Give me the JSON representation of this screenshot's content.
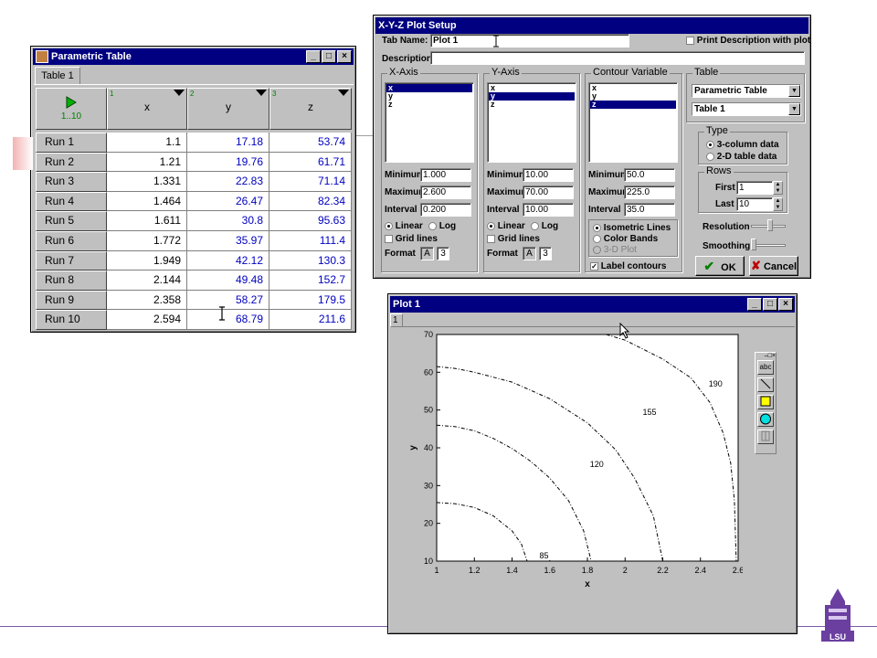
{
  "parametric_table": {
    "title": "Parametric Table",
    "tab": "Table 1",
    "run_range": "1..10",
    "columns": [
      {
        "index": "1",
        "name": "x"
      },
      {
        "index": "2",
        "name": "y"
      },
      {
        "index": "3",
        "name": "z"
      }
    ],
    "rows": [
      {
        "run": "Run 1",
        "x": "1.1",
        "y": "17.18",
        "z": "53.74"
      },
      {
        "run": "Run 2",
        "x": "1.21",
        "y": "19.76",
        "z": "61.71"
      },
      {
        "run": "Run 3",
        "x": "1.331",
        "y": "22.83",
        "z": "71.14"
      },
      {
        "run": "Run 4",
        "x": "1.464",
        "y": "26.47",
        "z": "82.34"
      },
      {
        "run": "Run 5",
        "x": "1.611",
        "y": "30.8",
        "z": "95.63"
      },
      {
        "run": "Run 6",
        "x": "1.772",
        "y": "35.97",
        "z": "111.4"
      },
      {
        "run": "Run 7",
        "x": "1.949",
        "y": "42.12",
        "z": "130.3"
      },
      {
        "run": "Run 8",
        "x": "2.144",
        "y": "49.48",
        "z": "152.7"
      },
      {
        "run": "Run 9",
        "x": "2.358",
        "y": "58.27",
        "z": "179.5"
      },
      {
        "run": "Run 10",
        "x": "2.594",
        "y": "68.79",
        "z": "211.6"
      }
    ]
  },
  "plot_setup": {
    "title": "X-Y-Z Plot Setup",
    "tab_name_label": "Tab Name:",
    "tab_name_value": "Plot 1",
    "print_desc_label": "Print Description with plot",
    "description_label": "Description:",
    "variables": [
      "x",
      "y",
      "z"
    ],
    "x_axis": {
      "label": "X-Axis",
      "selected": "x",
      "minimum": "1.000",
      "maximum": "2.600",
      "interval": "0.200",
      "format_a": "A",
      "format_n": "3"
    },
    "y_axis": {
      "label": "Y-Axis",
      "selected": "y",
      "minimum": "10.00",
      "maximum": "70.00",
      "interval": "10.00",
      "format_a": "A",
      "format_n": "3"
    },
    "contour": {
      "label": "Contour Variable",
      "selected": "z",
      "minimum": "50.0",
      "maximum": "225.0",
      "interval": "35.0",
      "opt_isometric": "Isometric Lines",
      "opt_color": "Color Bands",
      "opt_3d": "3-D Plot",
      "label_contours": "Label contours"
    },
    "labels": {
      "minimum": "Minimum",
      "maximum": "Maximum",
      "interval": "Interval",
      "linear": "Linear",
      "log": "Log",
      "grid": "Grid lines",
      "format": "Format"
    },
    "table": {
      "label": "Table",
      "source": "Parametric Table",
      "table": "Table 1"
    },
    "type": {
      "label": "Type",
      "opt1": "3-column data",
      "opt2": "2-D table data"
    },
    "rows": {
      "label": "Rows",
      "first_label": "First",
      "first": "1",
      "last_label": "Last",
      "last": "10"
    },
    "resolution_label": "Resolution",
    "smoothing_label": "Smoothing",
    "ok": "OK",
    "cancel": "Cancel"
  },
  "plot_window": {
    "title": "Plot 1",
    "tab": "1",
    "toolbar_text_tool": "abc"
  },
  "chart_data": {
    "type": "contour",
    "xlabel": "x",
    "ylabel": "y",
    "xlim": [
      1,
      2.6
    ],
    "ylim": [
      10,
      70
    ],
    "xticks": [
      "1",
      "1.2",
      "1.4",
      "1.6",
      "1.8",
      "2",
      "2.2",
      "2.4",
      "2.6"
    ],
    "yticks": [
      "10",
      "20",
      "30",
      "40",
      "50",
      "60",
      "70"
    ],
    "contour_levels": [
      "85",
      "120",
      "155",
      "190"
    ]
  }
}
